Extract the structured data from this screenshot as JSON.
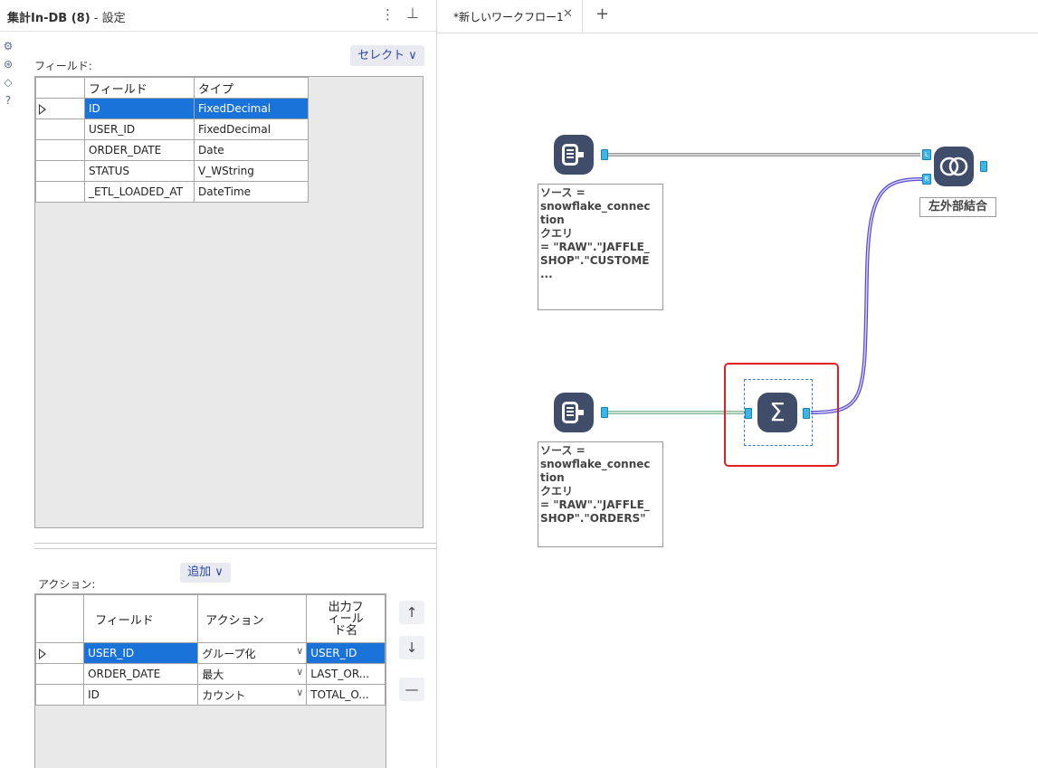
{
  "panel": {
    "title_bold": "集計In-DB (8)",
    "title_rest": " - 設定",
    "kebab": "⋮",
    "pin": "⊥"
  },
  "fields": {
    "label": "フィールド:",
    "select_label": "セレクト ∨",
    "headers": [
      "フィールド",
      "タイプ"
    ],
    "rows": [
      {
        "name": "ID",
        "type": "FixedDecimal"
      },
      {
        "name": "USER_ID",
        "type": "FixedDecimal"
      },
      {
        "name": "ORDER_DATE",
        "type": "Date"
      },
      {
        "name": "STATUS",
        "type": "V_WString"
      },
      {
        "name": "_ETL_LOADED_AT",
        "type": "DateTime"
      }
    ]
  },
  "actions": {
    "label": "アクション:",
    "add_label": "追加 ∨",
    "headers": [
      "フィールド",
      "アクション",
      "出力フィールド名"
    ],
    "header_out_lines": [
      "出力フ",
      "ィール",
      "ド名"
    ],
    "rows": [
      {
        "field": "USER_ID",
        "action": "グループ化",
        "out": "USER_ID"
      },
      {
        "field": "ORDER_DATE",
        "action": "最大",
        "out": "LAST_OR..."
      },
      {
        "field": "ID",
        "action": "カウント",
        "out": "TOTAL_O..."
      }
    ],
    "up": "↑",
    "down": "↓",
    "remove": "—"
  },
  "tabs": {
    "active_label": "*新しいワークフロー1",
    "close": "✕",
    "new": "+"
  },
  "workflow": {
    "source1_lines": [
      "ソース =",
      "snowflake_connec",
      "tion",
      "クエリ",
      "= \"RAW\".\"JAFFLE_",
      "SHOP\".\"CUSTOME",
      "..."
    ],
    "source2_lines": [
      "ソース =",
      "snowflake_connec",
      "tion",
      "クエリ",
      "= \"RAW\".\"JAFFLE_",
      "SHOP\".\"ORDERS\""
    ],
    "join_label": "左外部結合",
    "join_left_anchor": "L",
    "join_right_anchor": "R",
    "summarize_symbol": "Σ"
  },
  "colors": {
    "selection": "#1a73d9",
    "tool_body": "#3f4d6b",
    "anchor": "#3bb6e8",
    "selected_tool_border": "#e02020"
  }
}
